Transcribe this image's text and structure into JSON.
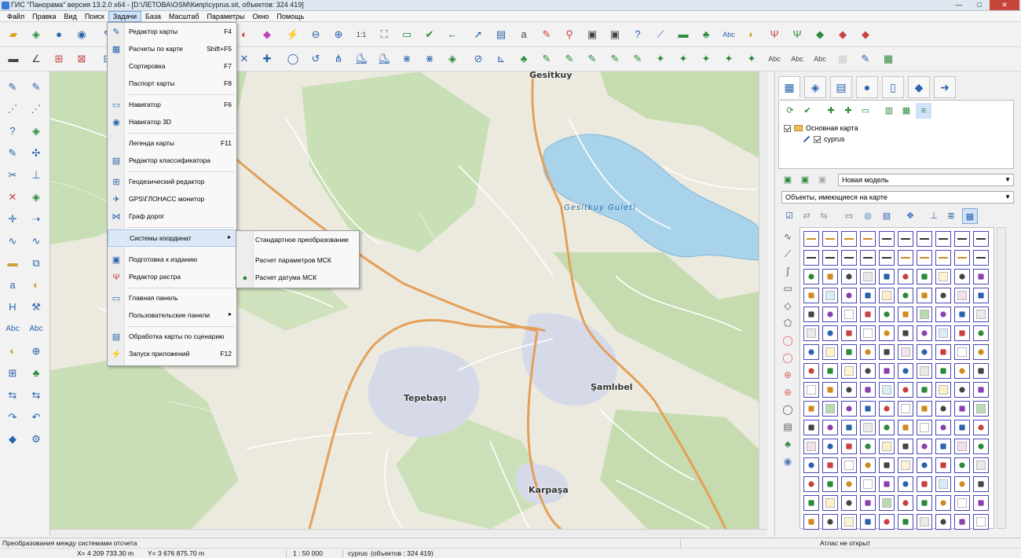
{
  "window": {
    "title": "ГИС \"Панорама\" версия 13.2.0 x64 - [D:\\ЛЕТОВА\\OSM\\Кипр\\cyprus.sit, объектов: 324 419]",
    "minimize": "—",
    "maximize": "□",
    "close": "✕"
  },
  "menubar": [
    "Файл",
    "Правка",
    "Вид",
    "Поиск",
    "Задачи",
    "База",
    "Масштаб",
    "Параметры",
    "Окно",
    "Помощь"
  ],
  "tasks_menu": {
    "items": [
      {
        "label": "Редактор карты",
        "shortcut": "F4",
        "icon": "pencil-icon"
      },
      {
        "label": "Расчеты по карте",
        "shortcut": "Shift+F5",
        "icon": "calculator-icon"
      },
      {
        "label": "Сортировка",
        "shortcut": "F7",
        "icon": ""
      },
      {
        "label": "Паспорт карты",
        "shortcut": "F8",
        "icon": ""
      },
      {
        "label": "Навигатор",
        "shortcut": "F6",
        "icon": "navigator-icon"
      },
      {
        "label": "Навигатор 3D",
        "shortcut": "",
        "icon": "navigator-3d-icon"
      },
      {
        "label": "Легенда карты",
        "shortcut": "F11",
        "icon": ""
      },
      {
        "label": "Редактор классификатора",
        "shortcut": "",
        "icon": "classifier-icon"
      },
      {
        "label": "Геодезический редактор",
        "shortcut": "",
        "icon": "geodesic-icon"
      },
      {
        "label": "GPS\\ГЛОНАСС монитор",
        "shortcut": "",
        "icon": "satellite-icon"
      },
      {
        "label": "Граф дорог",
        "shortcut": "",
        "icon": "road-graph-icon"
      },
      {
        "label": "Системы координат",
        "shortcut": "",
        "icon": "",
        "submenu": true
      },
      {
        "label": "Подготовка к изданию",
        "shortcut": "",
        "icon": "printer-icon"
      },
      {
        "label": "Редактор растра",
        "shortcut": "",
        "icon": "raster-icon"
      },
      {
        "label": "Главная панель",
        "shortcut": "",
        "icon": "panel-icon"
      },
      {
        "label": "Пользовательские панели",
        "shortcut": "",
        "icon": "",
        "submenu": true
      },
      {
        "label": "Обработка карты по сценарию",
        "shortcut": "",
        "icon": "script-icon"
      },
      {
        "label": "Запуск приложений",
        "shortcut": "F12",
        "icon": "lightning-icon"
      }
    ]
  },
  "coord_submenu": {
    "items": [
      "Стандартное преобразование",
      "Расчет параметров МСК",
      "Расчет датума МСК"
    ]
  },
  "map": {
    "labels": {
      "top": "Gesitkuy",
      "lake": "Gesitkuy Guleti",
      "town1": "Tepebaşı",
      "town2": "Şamlıbel",
      "town3": "Karpaşa"
    }
  },
  "right_panel": {
    "tree": {
      "root": "Основная карта",
      "child": "cyprus"
    },
    "model_select": "Новая модель",
    "objects_select": "Объекты, имеющиеся на карте"
  },
  "status": {
    "hint": "Преобразования между системами отсчета",
    "x": "X= 4 209 733.30 m",
    "y": "Y= 3 676 875.70 m",
    "scale": "1 : 50 000",
    "doc": "cyprus",
    "objects": "(объектов : 324 419)",
    "atlas": "Атлас не открыт"
  },
  "colors": {
    "map_land": "#eceadf",
    "map_forest": "#c5ddb0",
    "water": "#a9d3ea",
    "urban": "#d9dce8",
    "main_road": "#e4a05a",
    "minor_road": "#ffffff",
    "menu_highlight": "#dbe9f7"
  }
}
